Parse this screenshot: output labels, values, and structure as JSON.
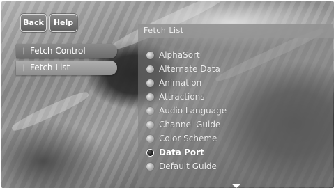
{
  "top_buttons": {
    "back_label": "Back",
    "help_label": "Help"
  },
  "sidebar": {
    "items": [
      {
        "label": "Fetch Control",
        "active": false
      },
      {
        "label": "Fetch List",
        "active": true
      }
    ]
  },
  "panel": {
    "title": "Fetch List",
    "items": [
      {
        "label": "AlphaSort",
        "selected": false
      },
      {
        "label": "Alternate Data",
        "selected": false
      },
      {
        "label": "Animation",
        "selected": false
      },
      {
        "label": "Attractions",
        "selected": false
      },
      {
        "label": "Audio Language",
        "selected": false
      },
      {
        "label": "Channel Guide",
        "selected": false
      },
      {
        "label": "Color Scheme",
        "selected": false
      },
      {
        "label": "Data Port",
        "selected": true
      },
      {
        "label": "Default Guide",
        "selected": false
      }
    ]
  }
}
